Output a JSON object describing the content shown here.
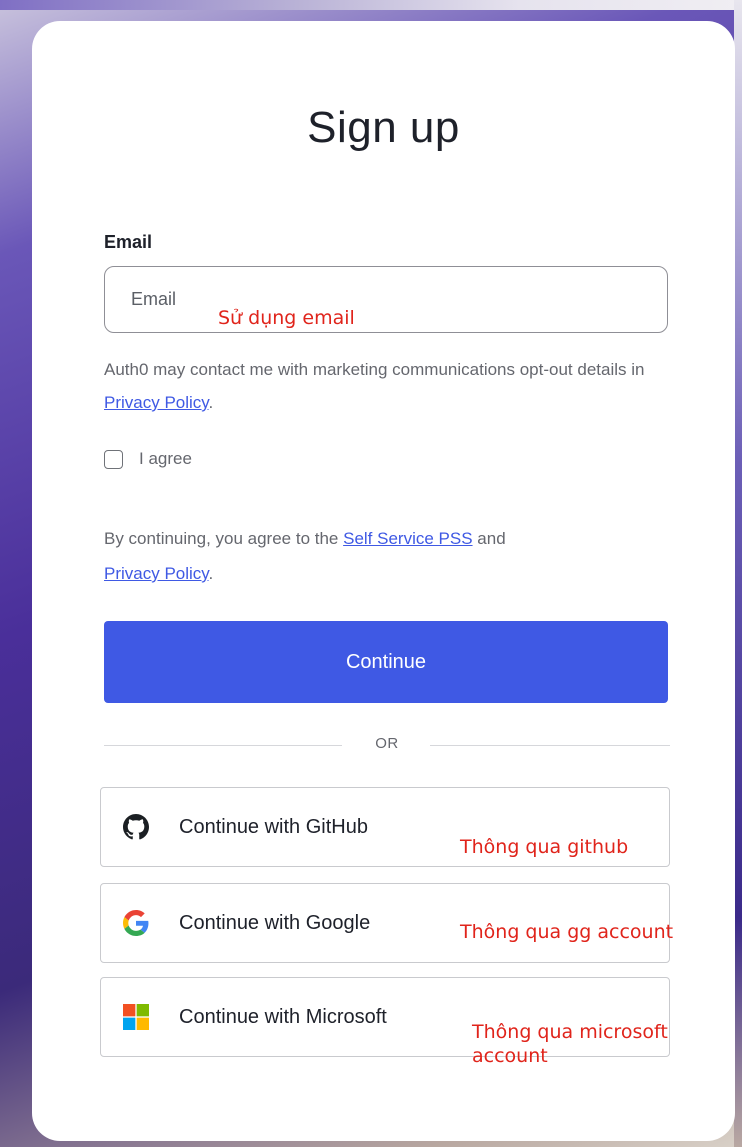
{
  "form": {
    "title": "Sign up",
    "email_label": "Email",
    "email_placeholder": "Email",
    "marketing_text": "Auth0 may contact me with marketing communications opt-out details in ",
    "marketing_link": "Privacy Policy",
    "marketing_end": ".",
    "agree_label": "I agree",
    "terms_prefix": "By continuing, you agree to the ",
    "terms_link_1": "Self Service PSS",
    "terms_and": " and ",
    "terms_link_2": "Privacy Policy",
    "terms_end": ".",
    "continue_label": "Continue",
    "or_label": "OR"
  },
  "social": [
    {
      "label": "Continue with GitHub",
      "icon": "github-icon"
    },
    {
      "label": "Continue with Google",
      "icon": "google-icon"
    },
    {
      "label": "Continue with Microsoft",
      "icon": "microsoft-icon"
    }
  ],
  "annotations": {
    "email": "Sử dụng email",
    "github": "Thông qua github",
    "google": "Thông qua gg account",
    "microsoft_line1": "Thông qua microsoft",
    "microsoft_line2": "account"
  },
  "colors": {
    "primary": "#3f59e4",
    "annotation": "#e0241b",
    "text": "#1e212a",
    "muted": "#65676e"
  }
}
